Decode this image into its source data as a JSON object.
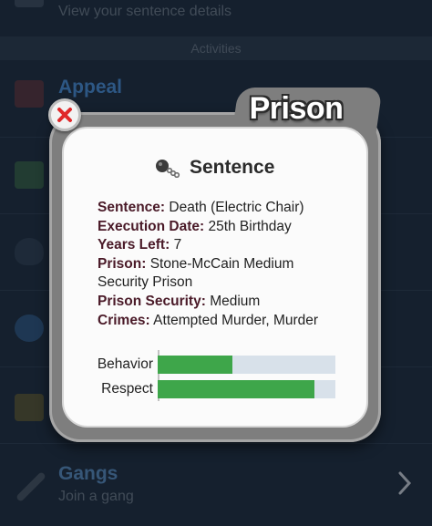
{
  "background": {
    "top_row_subtitle": "View your sentence details",
    "section_header": "Activities",
    "appeal": {
      "title": "Appeal"
    },
    "gangs": {
      "title": "Gangs",
      "subtitle": "Join a gang"
    }
  },
  "dialog": {
    "tab_title": "Prison",
    "heading": "Sentence",
    "details": [
      {
        "label": "Sentence:",
        "value": "Death (Electric Chair)"
      },
      {
        "label": "Execution Date:",
        "value": "25th Birthday"
      },
      {
        "label": "Years Left:",
        "value": "7"
      },
      {
        "label": "Prison:",
        "value": "Stone-McCain Medium Security Prison"
      },
      {
        "label": "Prison Security:",
        "value": "Medium"
      },
      {
        "label": "Crimes:",
        "value": "Attempted Murder, Murder"
      }
    ],
    "stats": [
      {
        "label": "Behavior",
        "value": 0.42
      },
      {
        "label": "Respect",
        "value": 0.88
      }
    ]
  },
  "colors": {
    "bar_fill": "#3ea64a",
    "bar_track": "#d8e1ea",
    "label": "#4a1a28",
    "link_blue": "#4a90d9"
  }
}
